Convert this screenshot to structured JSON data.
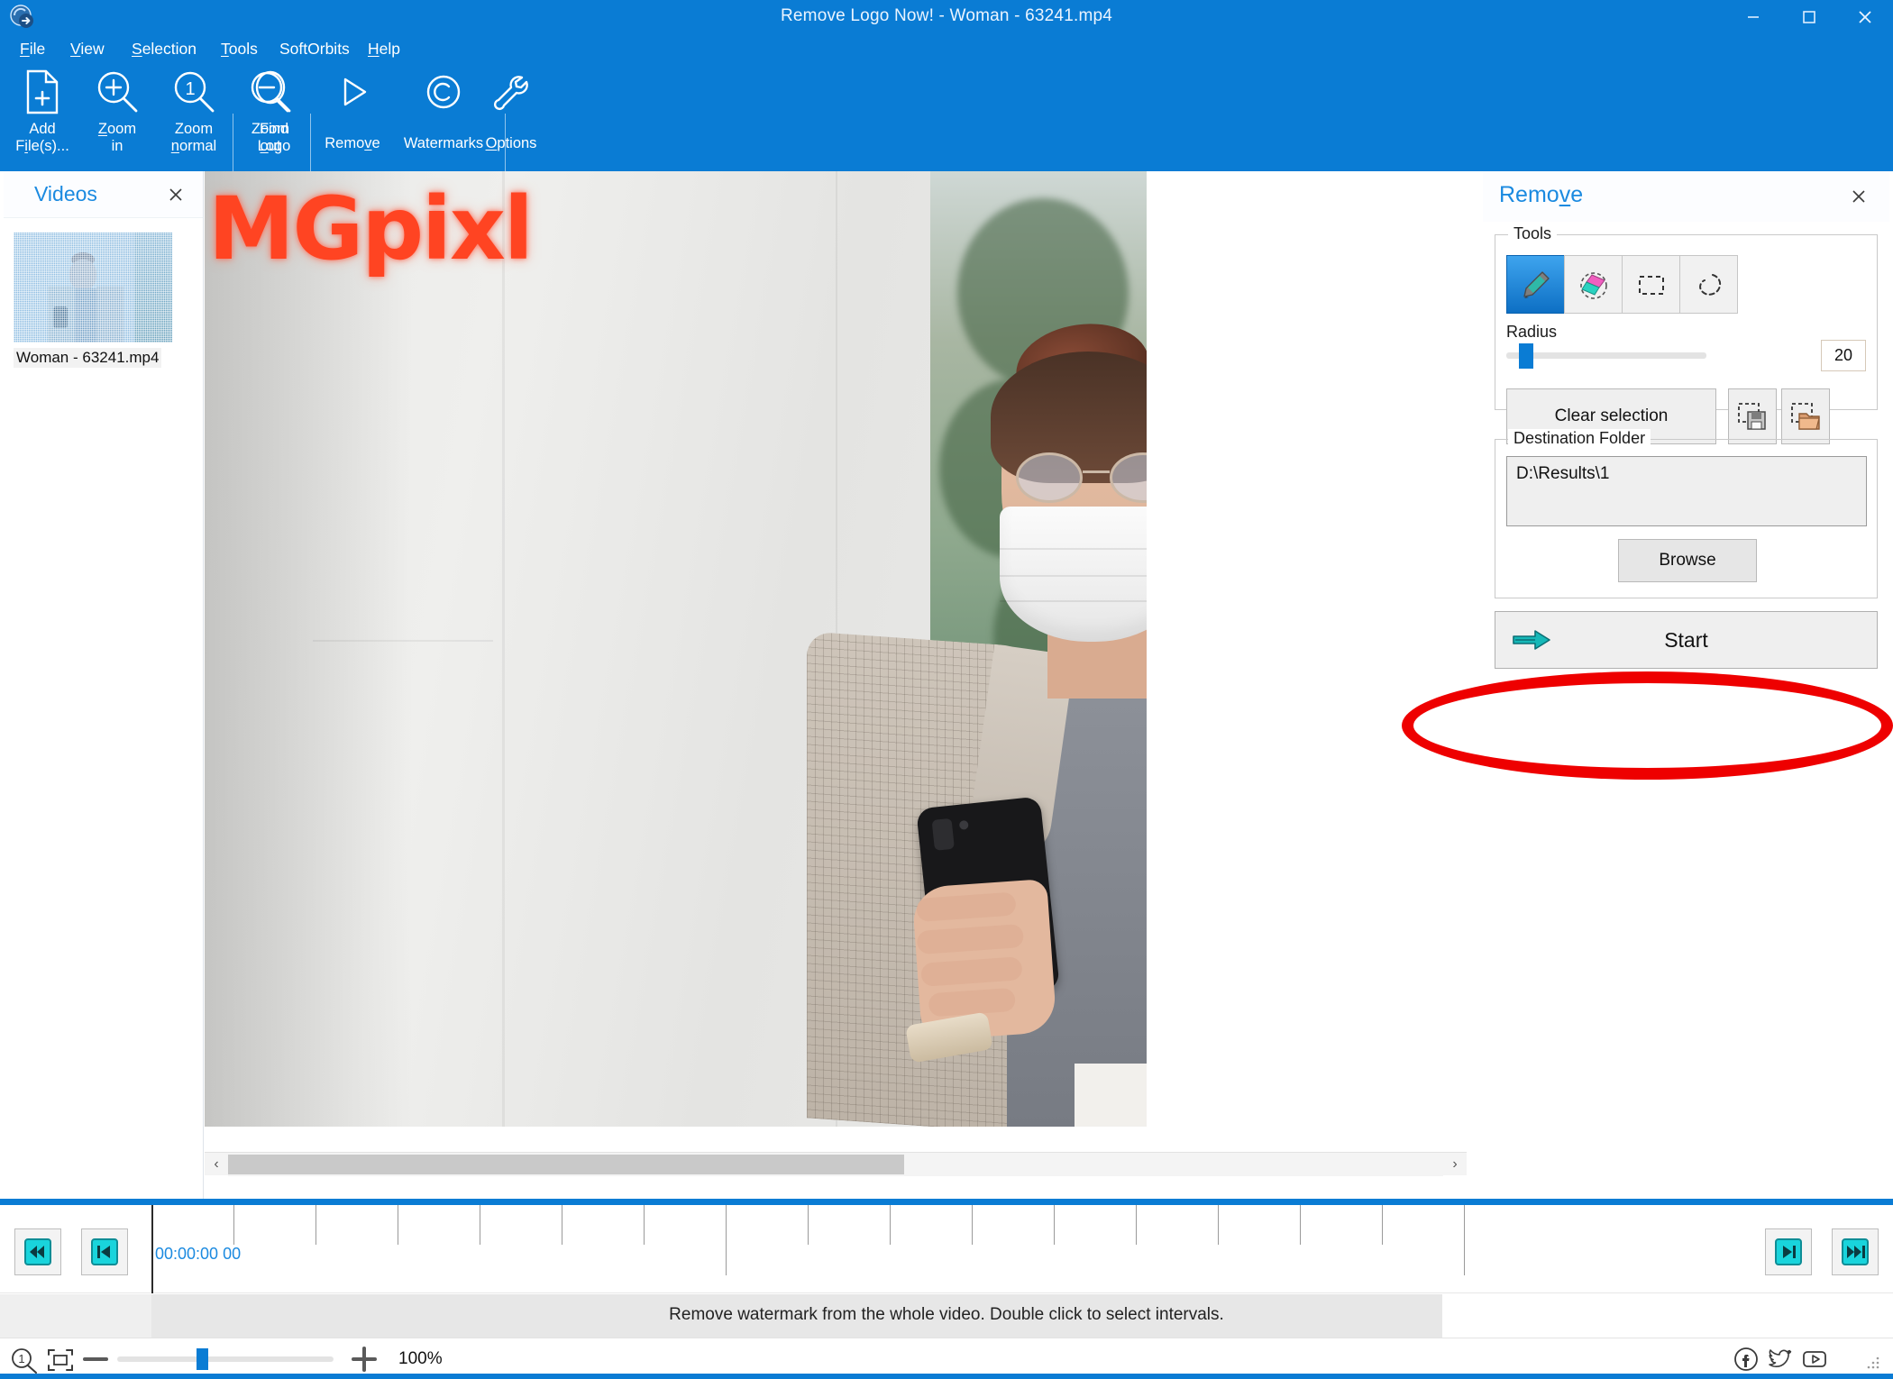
{
  "window": {
    "title": "Remove Logo Now! - Woman - 63241.mp4",
    "logo_icon": "app-logo-icon",
    "minimize_label": "–",
    "maximize_label": "☐",
    "close_label": "✕"
  },
  "menu": {
    "items": [
      {
        "label": "File",
        "accel": "F"
      },
      {
        "label": "View",
        "accel": "V"
      },
      {
        "label": "Selection",
        "accel": "S"
      },
      {
        "label": "Tools",
        "accel": "T"
      },
      {
        "label": "SoftOrbits",
        "accel": ""
      },
      {
        "label": "Help",
        "accel": "H"
      }
    ]
  },
  "toolbar": {
    "items": [
      {
        "name": "add-files",
        "icon": "add-file-icon",
        "line1": "Add",
        "line2": "File(s)...",
        "accel": "i"
      },
      {
        "name": "zoom-in",
        "icon": "zoom-in-icon",
        "line1": "Zoom",
        "line2": "in",
        "accel": "Z"
      },
      {
        "name": "zoom-normal",
        "icon": "zoom-normal-icon",
        "line1": "Zoom",
        "line2": "normal",
        "accel": "n"
      },
      {
        "name": "zoom-out",
        "icon": "zoom-out-icon",
        "line1": "Zoom",
        "line2": "out",
        "accel": "o"
      },
      {
        "name": "find-logo",
        "icon": "find-logo-icon",
        "line1": "Find",
        "line2": "Logo",
        "accel": ""
      },
      {
        "name": "remove-watermarks",
        "icon": "play-triangle-icon",
        "line1": "Remove",
        "line2": "",
        "accel": "v"
      },
      {
        "name": "watermarks",
        "icon": "copyright-icon",
        "line1": "Watermarks",
        "line2": "",
        "accel": ""
      },
      {
        "name": "options",
        "icon": "wrench-icon",
        "line1": "Options",
        "line2": "",
        "accel": "O"
      }
    ]
  },
  "videos_panel": {
    "title": "Videos",
    "close_label": "✕",
    "items": [
      {
        "name": "Woman - 63241.mp4",
        "selected": true
      }
    ]
  },
  "viewport": {
    "watermark_text": "MGpixl",
    "watermark_color": "#ff4422",
    "scroll_left_arrow": "‹",
    "scroll_right_arrow": "›"
  },
  "remove_panel": {
    "title": "Remove",
    "title_accel": "v",
    "close_label": "✕",
    "tools": {
      "group_label": "Tools",
      "buttons": [
        {
          "name": "marker-tool",
          "icon": "marker-icon",
          "active": true
        },
        {
          "name": "eraser-tool",
          "icon": "eraser-icon",
          "active": false
        },
        {
          "name": "rectangle-select-tool",
          "icon": "rectangle-select-icon",
          "active": false
        },
        {
          "name": "lasso-select-tool",
          "icon": "lasso-select-icon",
          "active": false
        }
      ]
    },
    "radius": {
      "label": "Radius",
      "value": "20",
      "slider_percent": 8
    },
    "clear_selection_label": "Clear selection",
    "save_selection_icon": "save-selection-icon",
    "load_selection_icon": "open-selection-icon",
    "destination": {
      "group_label": "Destination Folder",
      "path": "D:\\Results\\1",
      "browse_label": "Browse"
    },
    "start": {
      "label": "Start",
      "icon": "start-arrow-icon"
    },
    "annotation": {
      "shape": "ellipse",
      "color": "#ee0000"
    }
  },
  "timeline": {
    "first_frame_icon": "skip-to-start-icon",
    "prev_frame_icon": "step-back-icon",
    "next_frame_icon": "step-forward-icon",
    "last_frame_icon": "skip-to-end-icon",
    "current_time": "00:00:00 00",
    "status_message": "Remove watermark from the whole video. Double click to select intervals."
  },
  "statusbar": {
    "zoom_one_icon": "zoom-actual-size-icon",
    "fit_icon": "fit-to-window-icon",
    "zoom_out_label": "–",
    "zoom_in_label": "+",
    "zoom_percent": "100%",
    "zoom_slider_percent": 37,
    "social": [
      {
        "name": "facebook-icon"
      },
      {
        "name": "twitter-icon"
      },
      {
        "name": "youtube-icon"
      }
    ],
    "resize_grip_icon": "resize-grip-icon"
  },
  "theme": {
    "accent": "#0a7cd4",
    "panel_title": "#1b8ae0",
    "annotation_red": "#ee0000",
    "timeline_cyan": "#1fd0d8"
  }
}
